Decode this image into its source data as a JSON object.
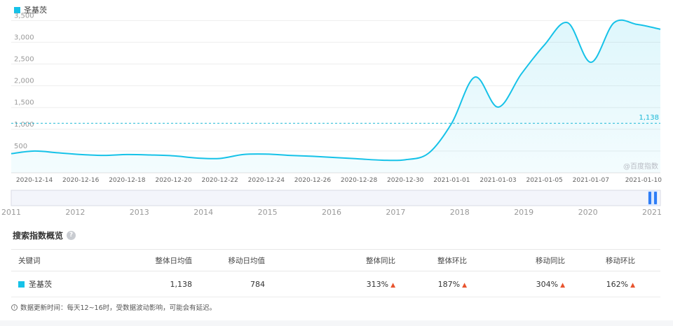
{
  "legend": {
    "label": "圣基茨",
    "color": "#16c2e8"
  },
  "watermark": "@百度指数",
  "chart_data": {
    "type": "area",
    "series": [
      {
        "name": "圣基茨",
        "x": [
          "2020-12-13",
          "2020-12-14",
          "2020-12-15",
          "2020-12-16",
          "2020-12-17",
          "2020-12-18",
          "2020-12-19",
          "2020-12-20",
          "2020-12-21",
          "2020-12-22",
          "2020-12-23",
          "2020-12-24",
          "2020-12-25",
          "2020-12-26",
          "2020-12-27",
          "2020-12-28",
          "2020-12-29",
          "2020-12-30",
          "2020-12-31",
          "2021-01-01",
          "2021-01-02",
          "2021-01-03",
          "2021-01-04",
          "2021-01-05",
          "2021-01-06",
          "2021-01-07",
          "2021-01-08",
          "2021-01-09",
          "2021-01-10"
        ],
        "values": [
          440,
          500,
          460,
          420,
          400,
          420,
          410,
          390,
          340,
          330,
          420,
          430,
          400,
          380,
          350,
          320,
          290,
          300,
          450,
          1140,
          2200,
          1510,
          2270,
          2940,
          3450,
          2540,
          3450,
          3410,
          3300
        ]
      }
    ],
    "reference_line": {
      "value": 1138,
      "label": "1,138"
    },
    "yticks": [
      500,
      1000,
      1500,
      2000,
      2500,
      3000,
      3500
    ],
    "ytick_labels": [
      "500",
      "1,000",
      "1,500",
      "2,000",
      "2,500",
      "3,000",
      "3,500"
    ],
    "ylim": [
      0,
      3650
    ],
    "xticks": [
      "2020-12-14",
      "2020-12-16",
      "2020-12-18",
      "2020-12-20",
      "2020-12-22",
      "2020-12-24",
      "2020-12-26",
      "2020-12-28",
      "2020-12-30",
      "2021-01-01",
      "2021-01-03",
      "2021-01-05",
      "2021-01-07",
      "2021-01-10"
    ],
    "grid": true,
    "legend_position": "top-left"
  },
  "timeline": {
    "years": [
      "2011",
      "2012",
      "2013",
      "2014",
      "2015",
      "2016",
      "2017",
      "2018",
      "2019",
      "2020",
      "2021"
    ]
  },
  "summary": {
    "title": "搜索指数概览",
    "help_icon_glyph": "?",
    "headers": {
      "keyword": "关键词",
      "overall_avg": "整体日均值",
      "mobile_avg": "移动日均值",
      "overall_yoy": "整体同比",
      "overall_mom": "整体环比",
      "mobile_yoy": "移动同比",
      "mobile_mom": "移动环比"
    },
    "row": {
      "keyword": "圣基茨",
      "overall_avg": "1,138",
      "mobile_avg": "784",
      "overall_yoy": "313%",
      "overall_mom": "187%",
      "mobile_yoy": "304%",
      "mobile_mom": "162%"
    },
    "up_arrow": "▲"
  },
  "footnote": "数据更新时间：每天12~16时，受数据波动影响，可能会有延迟。",
  "colors": {
    "accent": "#16c2e8",
    "reference": "#1bb8d6",
    "grid": "#eeeeee",
    "up": "#e8542e"
  }
}
